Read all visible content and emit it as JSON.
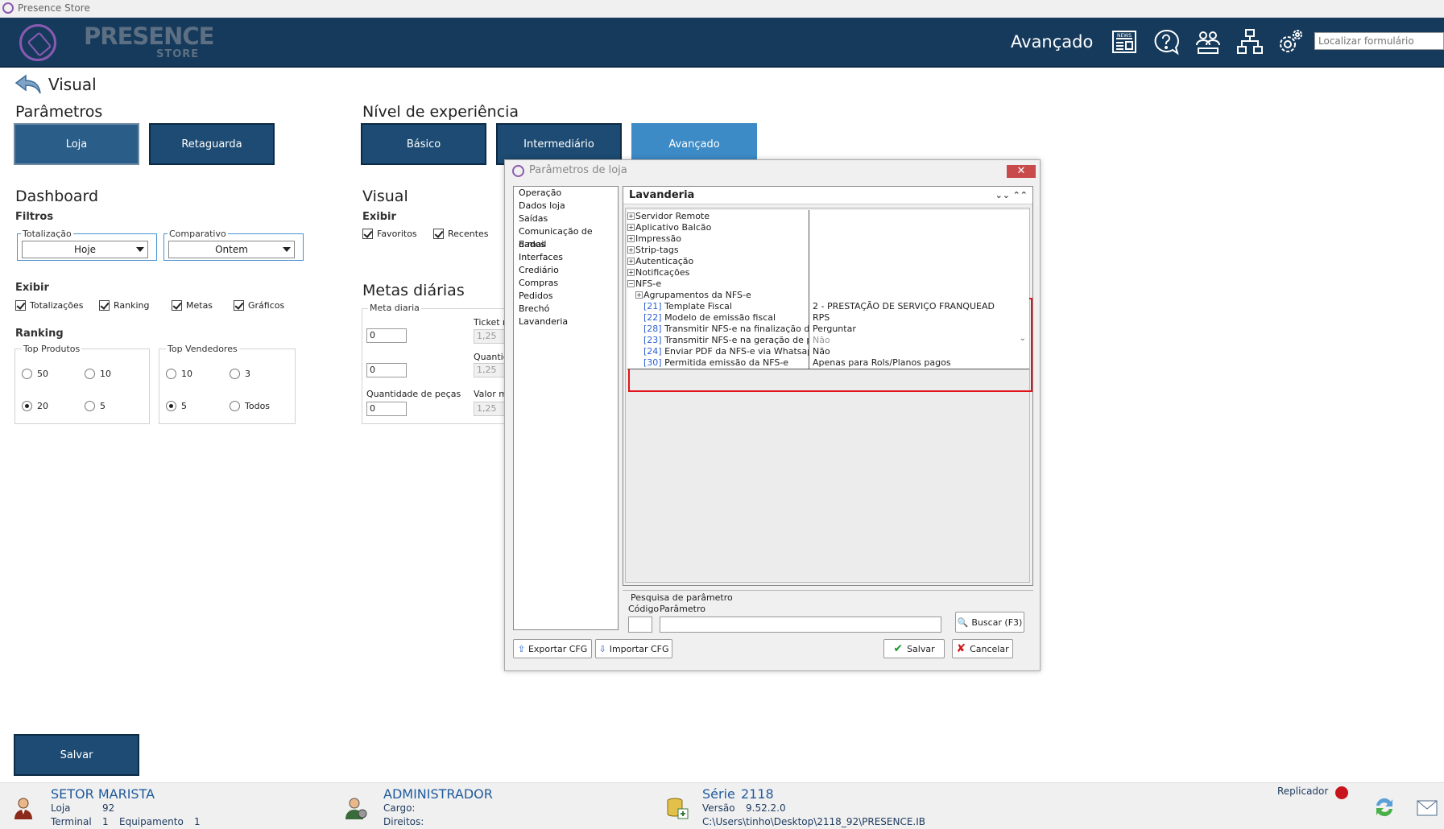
{
  "window": {
    "title": "Presence Store"
  },
  "header": {
    "logo_text": "PRESENCE",
    "logo_sub": "STORE",
    "mode_label": "Avançado",
    "search_placeholder": "Localizar formulário",
    "icons": [
      "news-icon",
      "help-chat-icon",
      "users-icon",
      "network-icon",
      "settings-icon"
    ]
  },
  "page": {
    "title": "Visual"
  },
  "parametros": {
    "heading": "Parâmetros",
    "loja": "Loja",
    "retaguarda": "Retaguarda"
  },
  "nivel": {
    "heading": "Nível de experiência",
    "basico": "Básico",
    "intermediario": "Intermediário",
    "avancado": "Avançado"
  },
  "dashboard": {
    "heading": "Dashboard",
    "filtros": "Filtros",
    "totalizacao_label": "Totalização",
    "totalizacao_value": "Hoje",
    "comparativo_label": "Comparativo",
    "comparativo_value": "Ontem",
    "exibir": "Exibir",
    "checks": [
      "Totalizações",
      "Ranking",
      "Metas",
      "Gráficos"
    ],
    "ranking": "Ranking",
    "top_produtos": "Top Produtos",
    "top_produtos_opts": [
      "50",
      "10",
      "20",
      "5"
    ],
    "top_produtos_selected": "20",
    "top_vendedores": "Top Vendedores",
    "top_vendedores_opts": [
      "10",
      "3",
      "5",
      "Todos"
    ],
    "top_vendedores_selected": "5"
  },
  "visual": {
    "heading": "Visual",
    "exibir": "Exibir",
    "favoritos": "Favoritos",
    "recentes": "Recentes",
    "metas_heading": "Metas diárias",
    "meta_diaria": "Meta diaria",
    "meta_value": "0",
    "second_value": "0",
    "ticket_label": "Ticket m",
    "ticket_value": "1,25",
    "quant_label": "Quantid",
    "quant_value": "1,25",
    "qtd_pecas_label": "Quantidade de peças",
    "qtd_pecas_value": "0",
    "valor_label": "Valor m",
    "valor_value": "1,25"
  },
  "salvar_main": "Salvar",
  "dialog": {
    "title": "Parâmetros de loja",
    "close": "✕",
    "nav": [
      "Operação",
      "Dados loja",
      "Saídas",
      "Comunicação de dados",
      "E-mail",
      "Interfaces",
      "Crediário",
      "Compras",
      "Pedidos",
      "Brechó",
      "Lavanderia"
    ],
    "panel_title": "Lavanderia",
    "groups": [
      "Servidor Remote",
      "Aplicativo Balcão",
      "Impressão",
      "Strip-tags",
      "Autenticação",
      "Notificações"
    ],
    "nfse": "NFS-e",
    "agrup": "Agrupamentos da NFS-e",
    "params": [
      {
        "code": "[21]",
        "name": "Template Fiscal",
        "value": "2 - PRESTAÇÃO DE SERVIÇO FRANQUEAD"
      },
      {
        "code": "[22]",
        "name": "Modelo de emissão fiscal",
        "value": "RPS"
      },
      {
        "code": "[28]",
        "name": "Transmitir NFS-e na finalização do Ro",
        "value": "Perguntar"
      },
      {
        "code": "[23]",
        "name": "Transmitir NFS-e na geração de préa",
        "value": "Não"
      },
      {
        "code": "[24]",
        "name": "Enviar PDF da NFS-e via Whatsapp",
        "value": "Não"
      },
      {
        "code": "[30]",
        "name": "Permitida emissão da NFS-e",
        "value": "Apenas para Rols/Planos pagos"
      }
    ],
    "pesquisa": "Pesquisa de parâmetro",
    "codigo": "Código",
    "parametro": "Parâmetro",
    "buscar": "Buscar (F3)",
    "exportar": "Exportar CFG",
    "importar": "Importar CFG",
    "salvar": "Salvar",
    "cancelar": "Cancelar"
  },
  "footer": {
    "loja_name": "SETOR MARISTA",
    "loja_label": "Loja",
    "loja_num": "92",
    "terminal_label": "Terminal",
    "terminal_num": "1",
    "equip_label": "Equipamento",
    "equip_num": "1",
    "user": "ADMINISTRADOR",
    "cargo": "Cargo:",
    "direitos": "Direitos:",
    "serie_label": "Série",
    "serie": "2118",
    "versao_label": "Versão",
    "versao": "9.52.2.0",
    "path": "C:\\Users\\tinho\\Desktop\\2118_92\\PRESENCE.IB",
    "replicador": "Replicador"
  }
}
